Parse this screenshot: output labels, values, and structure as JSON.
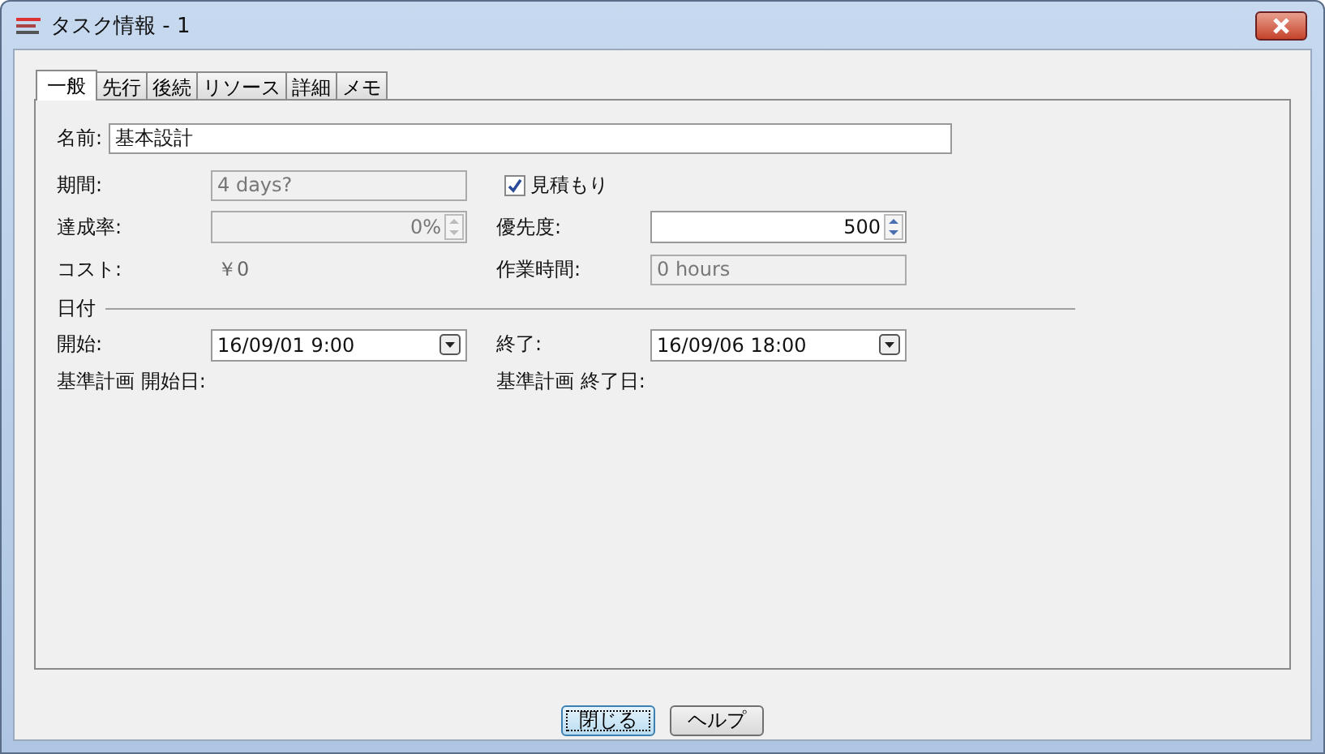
{
  "window": {
    "title": "タスク情報 - 1"
  },
  "tabs": [
    {
      "label": "一般",
      "selected": true
    },
    {
      "label": "先行",
      "selected": false
    },
    {
      "label": "後続",
      "selected": false
    },
    {
      "label": "リソース",
      "selected": false
    },
    {
      "label": "詳細",
      "selected": false
    },
    {
      "label": "メモ",
      "selected": false
    }
  ],
  "general": {
    "name": {
      "label": "名前:",
      "value": "基本設計"
    },
    "duration": {
      "label": "期間:",
      "value": "4 days?",
      "disabled": true
    },
    "estimated": {
      "label": "見積もり",
      "checked": true
    },
    "percent_complete": {
      "label": "達成率:",
      "value": "0%",
      "disabled": true
    },
    "priority": {
      "label": "優先度:",
      "value": "500",
      "disabled": false
    },
    "cost": {
      "label": "コスト:",
      "value": "￥0"
    },
    "work": {
      "label": "作業時間:",
      "value": "0 hours",
      "disabled": true
    },
    "dates": {
      "heading": "日付",
      "start": {
        "label": "開始:",
        "value": "16/09/01 9:00"
      },
      "finish": {
        "label": "終了:",
        "value": "16/09/06 18:00"
      },
      "baseline_start": {
        "label": "基準計画 開始日:"
      },
      "baseline_finish": {
        "label": "基準計画 終了日:"
      }
    }
  },
  "buttons": [
    {
      "label": "閉じる",
      "default": true
    },
    {
      "label": "ヘルプ",
      "default": false
    }
  ]
}
